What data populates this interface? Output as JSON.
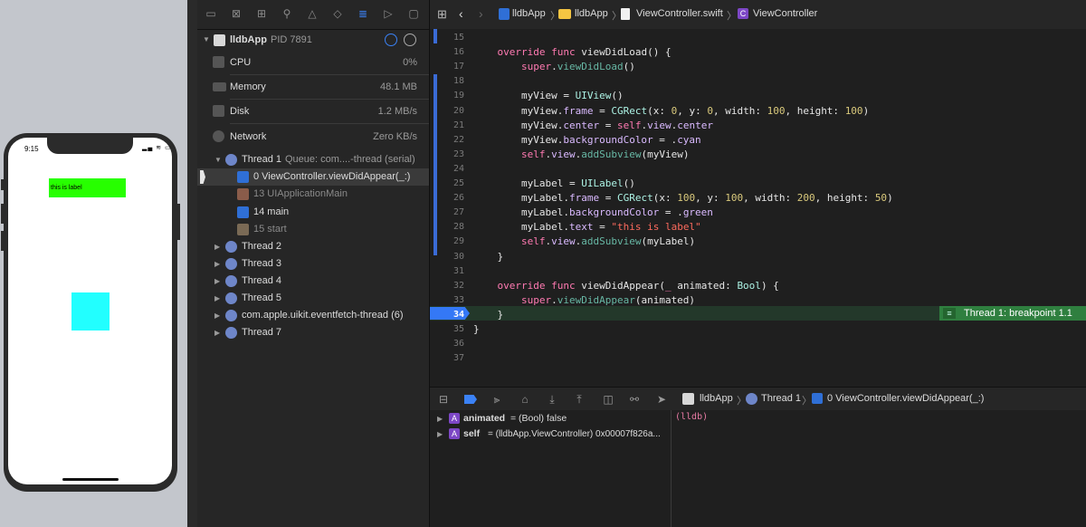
{
  "simulator": {
    "time": "9:15",
    "status_icons": "▂▄ ≋ ▭",
    "label_text": "this is label",
    "colors": {
      "label_bg": "#27ff00",
      "view_bg": "#22ffff"
    }
  },
  "navigator": {
    "process_name": "lldbApp",
    "pid": "PID 7891",
    "gauges": [
      {
        "label": "CPU",
        "value": "0%"
      },
      {
        "label": "Memory",
        "value": "48.1 MB"
      },
      {
        "label": "Disk",
        "value": "1.2 MB/s"
      },
      {
        "label": "Network",
        "value": "Zero KB/s"
      }
    ],
    "thread1": {
      "label": "Thread 1",
      "queue": "Queue: com....-thread (serial)"
    },
    "frames": [
      {
        "label": "0 ViewController.viewDidAppear(_:)"
      },
      {
        "label": "13 UIApplicationMain"
      },
      {
        "label": "14 main"
      },
      {
        "label": "15 start"
      }
    ],
    "threads": [
      {
        "label": "Thread 2"
      },
      {
        "label": "Thread 3"
      },
      {
        "label": "Thread 4"
      },
      {
        "label": "Thread 5"
      },
      {
        "label": "com.apple.uikit.eventfetch-thread (6)"
      },
      {
        "label": "Thread 7"
      }
    ]
  },
  "jumpbar": {
    "project": "lldbApp",
    "folder": "lldbApp",
    "file": "ViewController.swift",
    "symbol": "ViewController"
  },
  "code": {
    "line_numbers": [
      "15",
      "16",
      "17",
      "18",
      "19",
      "20",
      "21",
      "22",
      "23",
      "24",
      "25",
      "26",
      "27",
      "28",
      "29",
      "30",
      "31",
      "32",
      "33",
      "34",
      "35",
      "36",
      "37"
    ],
    "breakpoint_line": "34",
    "breakpoint_label": "Thread 1: breakpoint 1.1"
  },
  "debugbar": {
    "process": "lldbApp",
    "thread": "Thread 1",
    "frame": "0 ViewController.viewDidAppear(_:)"
  },
  "variables": [
    {
      "name": "animated",
      "detail": "= (Bool) false"
    },
    {
      "name": "self",
      "detail": "= (lldbApp.ViewController) 0x00007f826a..."
    }
  ],
  "console": {
    "prompt": "(lldb)"
  }
}
